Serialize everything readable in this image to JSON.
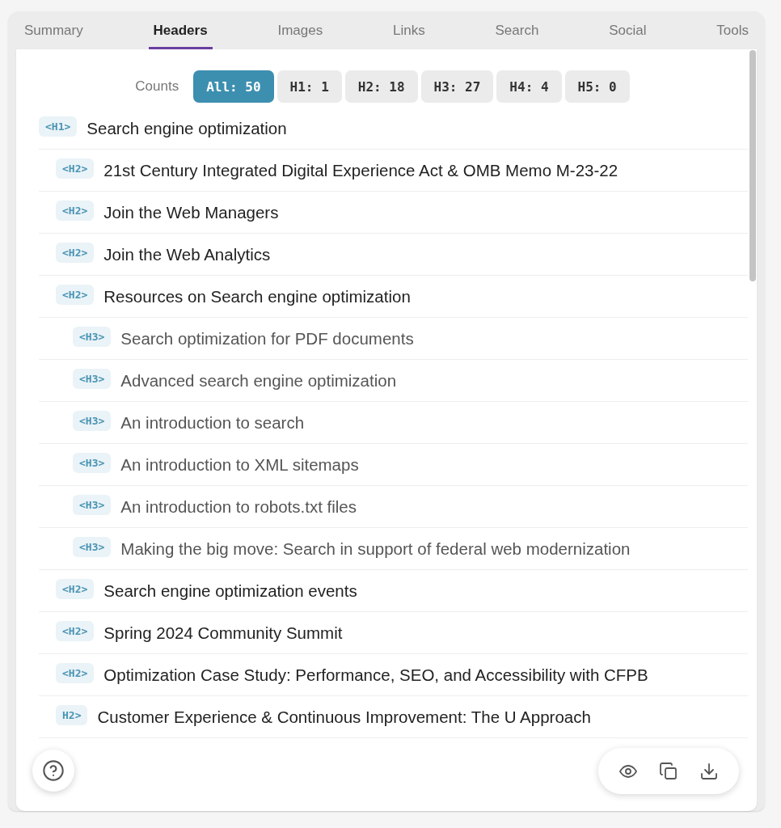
{
  "tabs": [
    {
      "label": "Summary",
      "selected": false
    },
    {
      "label": "Headers",
      "selected": true
    },
    {
      "label": "Images",
      "selected": false
    },
    {
      "label": "Links",
      "selected": false
    },
    {
      "label": "Search",
      "selected": false
    },
    {
      "label": "Social",
      "selected": false
    },
    {
      "label": "Tools",
      "selected": false
    }
  ],
  "counts": {
    "label": "Counts",
    "chips": [
      {
        "label": "All: 50",
        "selected": true
      },
      {
        "label": "H1: 1",
        "selected": false
      },
      {
        "label": "H2: 18",
        "selected": false
      },
      {
        "label": "H3: 27",
        "selected": false
      },
      {
        "label": "H4: 4",
        "selected": false
      },
      {
        "label": "H5: 0",
        "selected": false
      }
    ]
  },
  "headings": [
    {
      "tag": "<H1>",
      "text": "Search engine optimization",
      "children": [
        {
          "tag": "<H2>",
          "text": "21st Century Integrated Digital Experience Act & OMB Memo M-23-22"
        },
        {
          "tag": "<H2>",
          "text": "Join the Web Managers"
        },
        {
          "tag": "<H2>",
          "text": "Join the Web Analytics"
        },
        {
          "tag": "<H2>",
          "text": "Resources on Search engine optimization",
          "children": [
            {
              "tag": "<H3>",
              "text": "Search optimization for PDF documents"
            },
            {
              "tag": "<H3>",
              "text": "Advanced search engine optimization"
            },
            {
              "tag": "<H3>",
              "text": "An introduction to search"
            },
            {
              "tag": "<H3>",
              "text": "An introduction to XML sitemaps"
            },
            {
              "tag": "<H3>",
              "text": "An introduction to robots.txt files"
            },
            {
              "tag": "<H3>",
              "text": "Making the big move: Search in support of federal web modernization"
            }
          ]
        },
        {
          "tag": "<H2>",
          "text": "Search engine optimization events"
        },
        {
          "tag": "<H2>",
          "text": "Spring 2024 Community Summit"
        },
        {
          "tag": "<H2>",
          "text": "Optimization Case Study: Performance, SEO, and Accessibility with CFPB"
        },
        {
          "tag": "H2>",
          "text": "Customer Experience & Continuous Improvement: The U Approach"
        }
      ]
    }
  ]
}
